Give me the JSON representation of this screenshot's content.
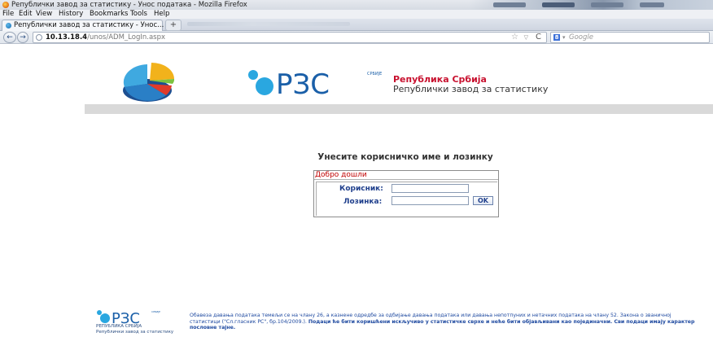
{
  "window": {
    "title": "Републички завод за статистику - Унос података - Mozilla Firefox"
  },
  "menu": [
    "File",
    "Edit",
    "View",
    "History",
    "Bookmarks",
    "Tools",
    "Help"
  ],
  "tab": {
    "label": "Републички завод за статистику - Унос...",
    "new_tab": "+"
  },
  "nav": {
    "back": "←",
    "forward": "→",
    "url_host": "10.13.18.4",
    "url_path": "/unos/ADM_LogIn.aspx",
    "star": "☆",
    "dropdown": "▽",
    "reload": "C",
    "search_engine": "8",
    "search_placeholder": "Google"
  },
  "header": {
    "logo_text": "РЗС",
    "logo_small": "СРБИЈЕ",
    "org_line1": "Република Србија",
    "org_line2": "Републички завод за статистику"
  },
  "login": {
    "prompt": "Унесите корисничко име и лозинку",
    "welcome": "Добро дошли",
    "username_label": "Корисник:",
    "password_label": "Лозинка:",
    "username_value": "",
    "password_value": "",
    "ok_label": "OK"
  },
  "footer": {
    "logo_text": "РЗС",
    "logo_small": "СРБИЈЕ",
    "sub1": "РЕПУБЛИКА СРБИЈА",
    "sub2": "Републички завод за статистику",
    "notice": "Обавеза давања података темељи се на члану 26, а казнене одредбе за одбијање давања података или давања непотпуних и нетачних података на члану 52. Закона о званичној статистици (\"Сл.гласник РС\", бр.104/2009.).",
    "notice_bold": "Подаци ће бити коришћени искључиво у статистичке сврхе и неће бити објављивани као појединачни. Сви подаци имају карактер пословне тајне."
  },
  "colors": {
    "brand_blue": "#1a5fa8",
    "brand_cyan": "#2aa7e0",
    "brand_red": "#c8102e",
    "label_blue": "#1f3f8c"
  }
}
